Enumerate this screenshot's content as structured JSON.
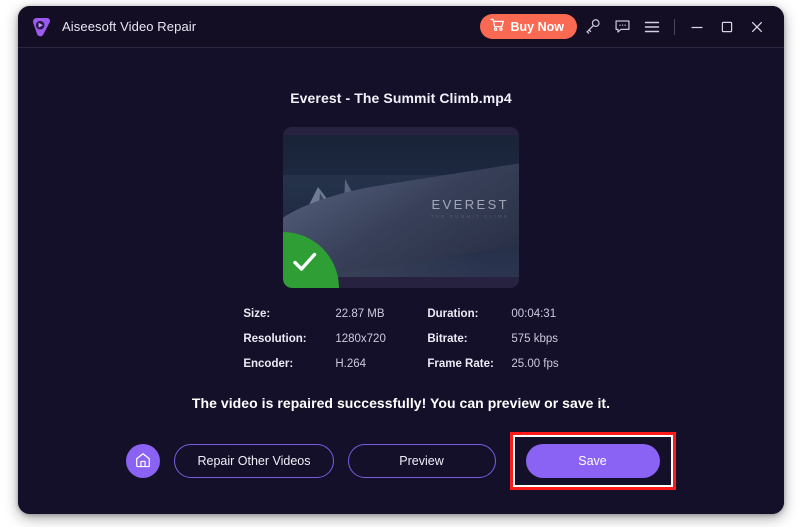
{
  "window": {
    "title": "Aiseesoft Video Repair",
    "logo_icon": "aiseesoft-play-logo"
  },
  "titlebar": {
    "buy_now_label": "Buy Now",
    "cart_icon": "shopping-cart-icon",
    "register_icon": "key-icon",
    "feedback_icon": "chat-bubble-icon",
    "menu_icon": "hamburger-menu-icon",
    "minimize_icon": "minimize-icon",
    "maximize_icon": "maximize-icon",
    "close_icon": "close-icon"
  },
  "main": {
    "file_name": "Everest - The Summit Climb.mp4",
    "thumbnail": {
      "overlay_title": "EVEREST",
      "overlay_subtitle": "THE SUMMIT CLIMB",
      "badge_icon": "check-mark-icon"
    },
    "metadata": [
      {
        "label": "Size:",
        "value": "22.87 MB"
      },
      {
        "label": "Duration:",
        "value": "00:04:31"
      },
      {
        "label": "Resolution:",
        "value": "1280x720"
      },
      {
        "label": "Bitrate:",
        "value": "575 kbps"
      },
      {
        "label": "Encoder:",
        "value": "H.264"
      },
      {
        "label": "Frame Rate:",
        "value": "25.00 fps"
      }
    ],
    "status_message": "The video is repaired successfully! You can preview or save it.",
    "actions": {
      "home_icon": "home-icon",
      "repair_other_label": "Repair Other Videos",
      "preview_label": "Preview",
      "save_label": "Save"
    }
  },
  "colors": {
    "window_bg": "#15102a",
    "titlebar_bg": "#130e24",
    "accent_purple": "#8a63f5",
    "buy_now_coral": "#fa6a52",
    "success_green": "#2e9e35",
    "highlight_red": "#ff1b1b"
  }
}
